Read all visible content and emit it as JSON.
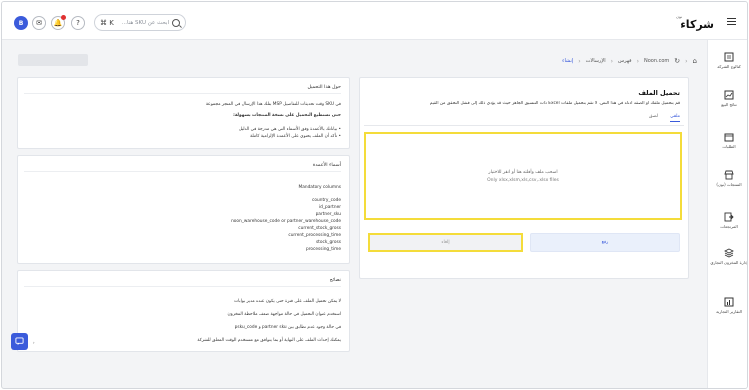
{
  "header": {
    "avatar_initial": "B",
    "search_placeholder": "ابحث عن SKU هنا...",
    "search_shortcut": "⌘ K",
    "logo_small": "نون",
    "logo_big": "شركاء"
  },
  "sidebar": {
    "items": [
      {
        "label": "كتالوج الشركة",
        "icon": "catalog-icon"
      },
      {
        "label": "نتائج البيع",
        "icon": "chart-icon"
      },
      {
        "label": "الطلبات",
        "icon": "orders-icon"
      },
      {
        "label": "المنتجات (نون)",
        "icon": "shop-icon"
      },
      {
        "label": "المرتجعات",
        "icon": "return-icon"
      },
      {
        "label": "إدارة المخزون التجاري",
        "icon": "inventory-icon"
      },
      {
        "label": "التقارير التجارية",
        "icon": "report-icon"
      }
    ]
  },
  "breadcrumb": {
    "items": [
      "Noon.com",
      "فهرس",
      "الإرسالات",
      "إنشاء"
    ]
  },
  "upload": {
    "title": "تحميل الملف",
    "description": "قم بتحميل ملفك أو الصقه أدناه في هذا النص. لا تقم بتحميل ملفات Excel ذات التنسيق الجاهز حيث قد يؤدي ذلك إلى فشل التحقق من القيم",
    "tabs": [
      "ملفي",
      "لصق"
    ],
    "dropzone_text": "اسحب ملف وأفلته هنا أو انقر للاختيار",
    "dropzone_formats": "Only xlsx,xlsm,xls,csv,.xlsx files",
    "upload_button": "رفع",
    "cancel_button": "إلغاء"
  },
  "about_card": {
    "title": "حول هذا التحميل",
    "intro": "في SKU وقت تحديثات للتفاصيل MSP بتلك هذا الإرسال في المتجر مجموعة",
    "subtitle": "حتى تستطيع التحميل على نسخة المنتجات بسهولة:",
    "bullets": [
      "• بياناتك بالأعمدة وفق الأسماء التي هي مدرجة في الدليل",
      "• تأكد أن الملف يحتوي على الأعمدة الإلزامية كاملة"
    ]
  },
  "columns_card": {
    "title": "أسماء الأعمدة",
    "mandatory_label": "Mandatory columns",
    "columns": [
      "country_code",
      "id_partner",
      "partner_sku",
      "noon_warehouse_code or partner_warehouse_code",
      "current_stock_gross",
      "current_processing_time",
      "stock_gross",
      "processing_time"
    ]
  },
  "tips_card": {
    "title": "نصائح",
    "lines": [
      "لا يمكن تحميل الملف على فترة حتى يكون عنده مدير بوابات",
      "استخدم عنوان التحميل في حالة مواجهة ضعف ملاحظة المخزون",
      "في حالة وجود عدم تطابق بين partner sku و psku_code",
      "يمكنك إحداث الملف على النهاية أو بما يتوافق مع مستخدم الوقت المعلق للشركة"
    ]
  },
  "colors": {
    "accent": "#3b5bdb",
    "highlight": "#f4dc3a",
    "badge": "#e03131"
  }
}
